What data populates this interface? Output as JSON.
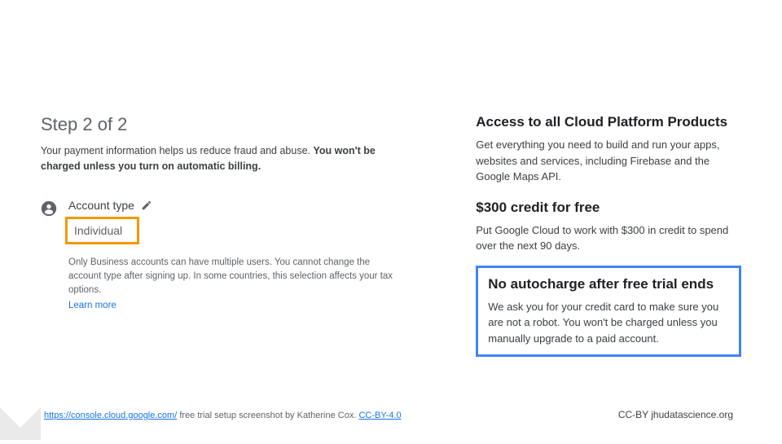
{
  "left": {
    "step_title": "Step 2 of 2",
    "desc_plain": "Your payment information helps us reduce fraud and abuse. ",
    "desc_bold": "You won't be charged unless you turn on automatic billing.",
    "account_label": "Account type",
    "account_value": "Individual",
    "account_note": "Only Business accounts can have multiple users. You cannot change the account type after signing up. In some countries, this selection affects your tax options.",
    "learn_more": "Learn more"
  },
  "right": {
    "b1_title": "Access to all Cloud Platform Products",
    "b1_body": "Get everything you need to build and run your apps, websites and services, including Firebase and the Google Maps API.",
    "b2_title": "$300 credit for free",
    "b2_body": "Put Google Cloud to work with $300 in credit to spend over the next 90 days.",
    "b3_title": "No autocharge after free trial ends",
    "b3_body": "We ask you for your credit card to make sure you are not a robot. You won't be charged unless you manually upgrade to a paid account."
  },
  "footer": {
    "url": "https://console.cloud.google.com/",
    "credit_mid": " free trial setup screenshot by Katherine Cox. ",
    "license": "CC-BY-4.0",
    "right": "CC-BY  jhudatascience.org"
  }
}
